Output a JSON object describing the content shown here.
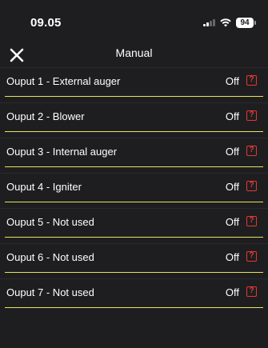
{
  "status_bar": {
    "time": "09.05",
    "battery_level": "94",
    "icons": [
      "signal-icon",
      "wifi-icon",
      "battery-icon"
    ]
  },
  "nav": {
    "title": "Manual",
    "close_icon": "close-icon"
  },
  "outputs": [
    {
      "label": "Ouput 1 - External auger",
      "state": "Off",
      "help": "?"
    },
    {
      "label": "Ouput 2 - Blower",
      "state": "Off",
      "help": "?"
    },
    {
      "label": "Ouput 3 - Internal auger",
      "state": "Off",
      "help": "?"
    },
    {
      "label": "Ouput 4 - Igniter",
      "state": "Off",
      "help": "?"
    },
    {
      "label": "Ouput 5 - Not used",
      "state": "Off",
      "help": "?"
    },
    {
      "label": "Ouput 6 - Not used",
      "state": "Off",
      "help": "?"
    },
    {
      "label": "Ouput 7 - Not used",
      "state": "Off",
      "help": "?"
    }
  ],
  "colors": {
    "background": "#1e1e21",
    "divider_accent": "#e6e45a",
    "help_icon": "#e23a2e",
    "text": "#ffffff"
  }
}
